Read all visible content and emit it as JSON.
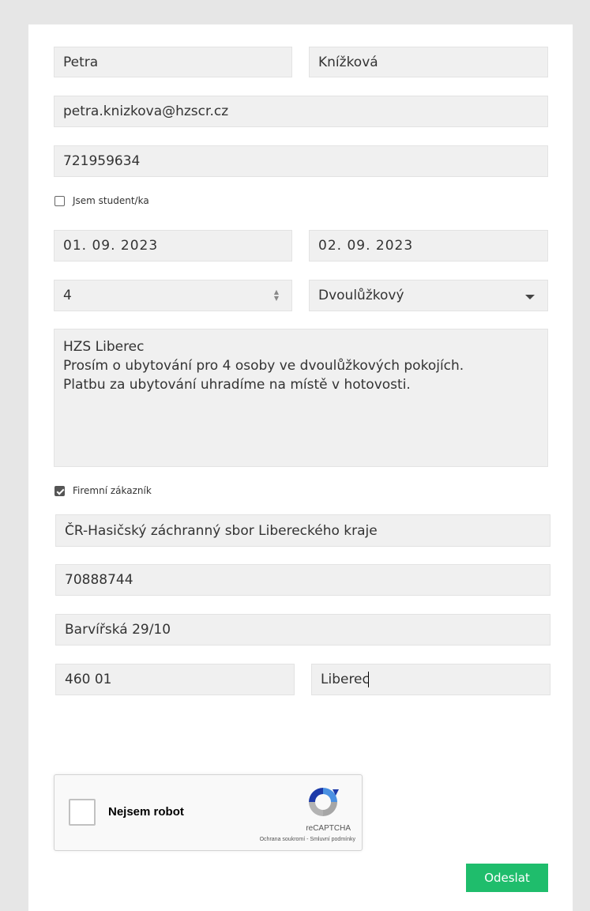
{
  "form": {
    "first_name": "Petra",
    "last_name": "Knížková",
    "email": "petra.knizkova@hzscr.cz",
    "phone": "721959634",
    "student_label": "Jsem student/ka",
    "student_checked": false,
    "date_from": "01. 09. 2023",
    "date_to": "02. 09. 2023",
    "guests": "4",
    "room_type": "Dvoulůžkový",
    "note_lines": [
      "HZS Liberec",
      "Prosím o ubytování pro 4 osoby ve dvoulůžkových pokojích.",
      "Platbu za ubytování uhradíme na místě v hotovosti."
    ],
    "company_label": "Firemní zákazník",
    "company_checked": true,
    "company_name": "ČR-Hasičský záchranný sbor Libereckého kraje",
    "company_id": "70888744",
    "street": "Barvířská 29/10",
    "zip": "460 01",
    "city": "Liberec"
  },
  "recaptcha": {
    "label": "Nejsem robot",
    "brand": "reCAPTCHA",
    "links": "Ochrana soukromí - Smluvní podmínky"
  },
  "submit_label": "Odeslat",
  "colors": {
    "submit": "#1fbd6c",
    "background": "#e6e6e6",
    "field": "#f0f0f0"
  }
}
